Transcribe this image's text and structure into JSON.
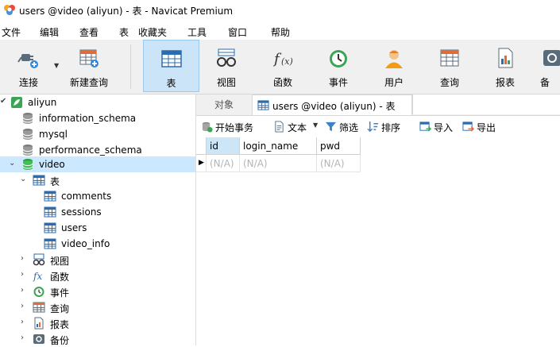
{
  "window": {
    "title": "users @video (aliyun) - 表 - Navicat Premium"
  },
  "menu": [
    "文件",
    "编辑",
    "查看",
    "表",
    "收藏夹",
    "工具",
    "窗口",
    "帮助"
  ],
  "toolbar": {
    "buttons": [
      {
        "label": "连接",
        "icon": "connect-plug-icon"
      },
      {
        "label": "新建查询",
        "icon": "new-query-icon"
      },
      {
        "label": "表",
        "icon": "table-icon",
        "active": true
      },
      {
        "label": "视图",
        "icon": "view-glasses-icon"
      },
      {
        "label": "函数",
        "icon": "function-fx-icon"
      },
      {
        "label": "事件",
        "icon": "event-clock-icon"
      },
      {
        "label": "用户",
        "icon": "user-icon"
      },
      {
        "label": "查询",
        "icon": "query-icon"
      },
      {
        "label": "报表",
        "icon": "report-icon"
      },
      {
        "label": "备",
        "icon": "backup-icon"
      }
    ]
  },
  "tree": {
    "connection": "aliyun",
    "databases": [
      "information_schema",
      "mysql",
      "performance_schema",
      "video"
    ],
    "video": {
      "tables_label": "表",
      "tables": [
        "comments",
        "sessions",
        "users",
        "video_info"
      ],
      "other": [
        "视图",
        "函数",
        "事件",
        "查询",
        "报表",
        "备份"
      ]
    }
  },
  "tabs": {
    "objects": "对象",
    "active": "users @video (aliyun) - 表"
  },
  "subtoolbar": {
    "begin_transaction": "开始事务",
    "text": "文本",
    "filter": "筛选",
    "sort": "排序",
    "import": "导入",
    "export": "导出"
  },
  "grid": {
    "columns": [
      "id",
      "login_name",
      "pwd"
    ],
    "row": [
      "(N/A)",
      "(N/A)",
      "(N/A)"
    ]
  },
  "colors": {
    "selection": "#cce8ff",
    "toolbar_active": "#cce4f7",
    "toolbar_bg": "#f0f0f0"
  }
}
